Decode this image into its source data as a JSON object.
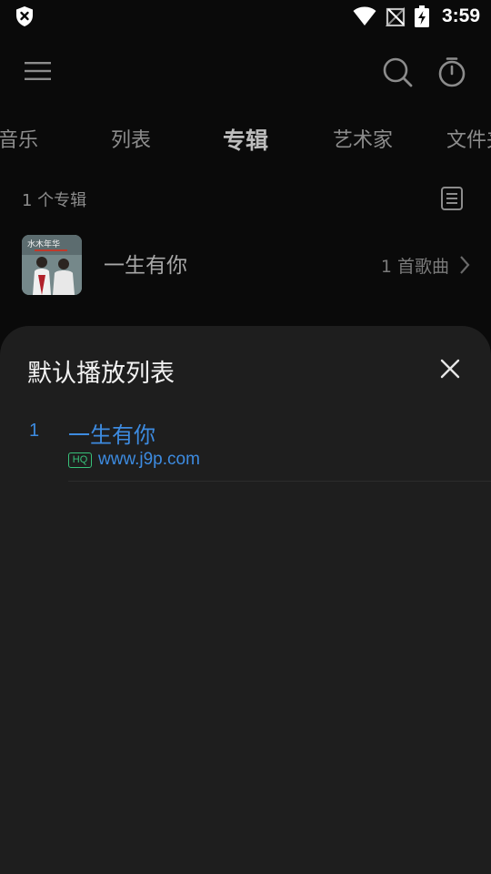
{
  "status_bar": {
    "time": "3:59",
    "icons": [
      "shield-x-icon",
      "wifi-icon",
      "no-signal-icon",
      "battery-charging-icon"
    ]
  },
  "toolbar": {
    "icons": [
      "menu-icon",
      "search-icon",
      "timer-icon"
    ]
  },
  "tabs": [
    {
      "label": "音乐",
      "active": false
    },
    {
      "label": "列表",
      "active": false
    },
    {
      "label": "专辑",
      "active": true
    },
    {
      "label": "艺术家",
      "active": false
    },
    {
      "label": "文件夹",
      "active": false
    }
  ],
  "album_list": {
    "count_label": "1 个专辑",
    "albums": [
      {
        "title": "一生有你",
        "song_count": "1 首歌曲",
        "cover_text": "水木年华"
      }
    ]
  },
  "playlist_sheet": {
    "title": "默认播放列表",
    "songs": [
      {
        "index": "1",
        "title": "一生有你",
        "quality": "HQ",
        "artist": "www.j9p.com"
      }
    ]
  },
  "colors": {
    "background": "#0a0a0a",
    "sheet": "#1e1e1e",
    "accent": "#3d8be0",
    "hq_badge": "#37c27a"
  }
}
